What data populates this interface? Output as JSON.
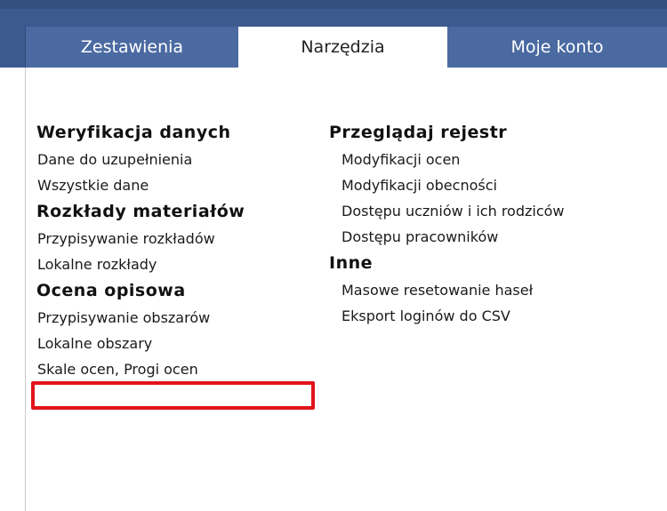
{
  "tabs": [
    {
      "label": "Zestawienia",
      "active": false
    },
    {
      "label": "Narzędzia",
      "active": true
    },
    {
      "label": "Moje konto",
      "active": false
    }
  ],
  "menu": {
    "left": {
      "verification": {
        "heading": "Weryfikacja danych",
        "items": [
          "Dane do uzupełnienia",
          "Wszystkie dane"
        ]
      },
      "materials": {
        "heading": "Rozkłady materiałów",
        "items": [
          "Przypisywanie rozkładów",
          "Lokalne rozkłady"
        ]
      },
      "descriptive": {
        "heading": "Ocena opisowa",
        "items": [
          "Przypisywanie obszarów",
          "Lokalne obszary",
          "Skale ocen,  Progi ocen"
        ]
      }
    },
    "right": {
      "registry": {
        "heading": "Przeglądaj rejestr",
        "items": [
          "Modyfikacji ocen",
          "Modyfikacji obecności",
          "Dostępu uczniów i ich rodziców",
          "Dostępu pracowników"
        ]
      },
      "other": {
        "heading": "Inne",
        "items": [
          "Masowe resetowanie haseł",
          "Eksport loginów do CSV"
        ]
      }
    }
  },
  "highlighted_item": "Przypisywanie obszarów",
  "colors": {
    "nav_bar": "#3d5a8f",
    "tab_inactive": "#4b6aa2",
    "tab_active": "#ffffff",
    "highlight_border": "#e0141a"
  }
}
